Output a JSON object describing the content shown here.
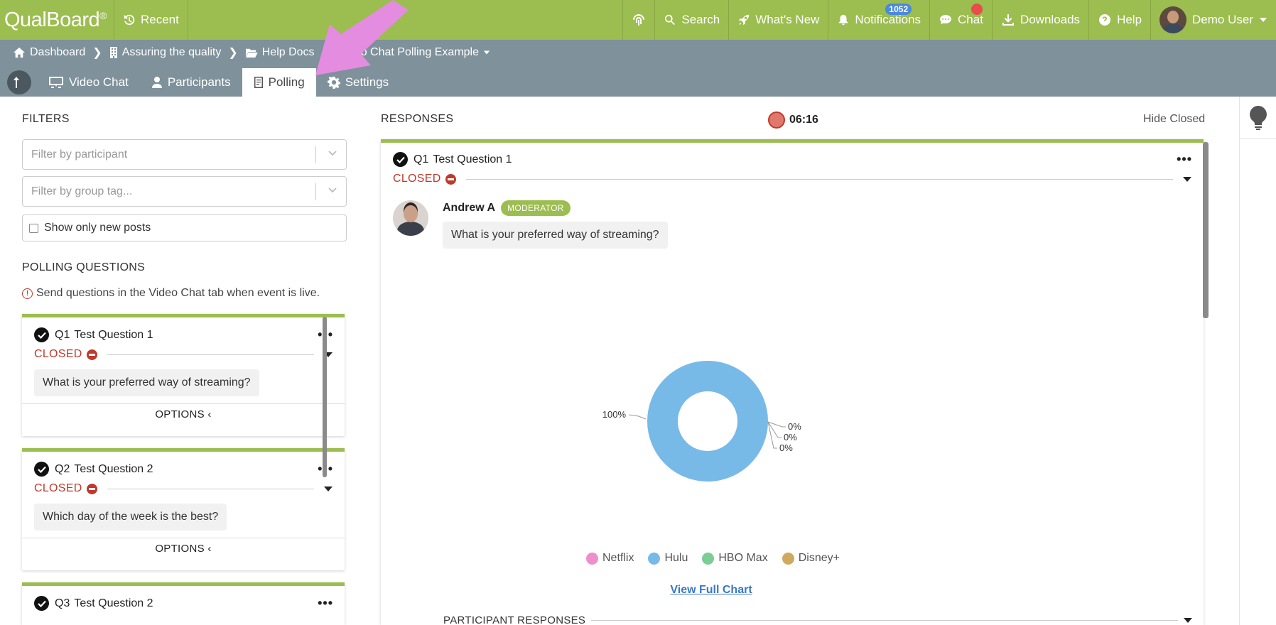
{
  "topbar": {
    "logo": "QualBoard",
    "recent": "Recent",
    "search": "Search",
    "whats_new": "What's New",
    "notifications": "Notifications",
    "notifications_count": "1052",
    "chat": "Chat",
    "downloads": "Downloads",
    "help": "Help",
    "user": "Demo User"
  },
  "breadcrumb": {
    "items": [
      "Dashboard",
      "Assuring the quality",
      "Help Docs",
      "Video Chat Polling Example"
    ]
  },
  "tabs": [
    "Video Chat",
    "Participants",
    "Polling",
    "Settings"
  ],
  "active_tab": "Polling",
  "filters": {
    "title": "FILTERS",
    "participant_placeholder": "Filter by participant",
    "group_tag_placeholder": "Filter by group tag...",
    "show_new_label": "Show only new posts"
  },
  "polling": {
    "title": "POLLING QUESTIONS",
    "notice": "Send questions in the Video Chat tab when event is live.",
    "questions": [
      {
        "num": "Q1",
        "title": "Test Question 1",
        "status": "CLOSED",
        "text": "What is your preferred way of streaming?",
        "options": "OPTIONS"
      },
      {
        "num": "Q2",
        "title": "Test Question 2",
        "status": "CLOSED",
        "text": "Which day of the week is the best?",
        "options": "OPTIONS"
      },
      {
        "num": "Q3",
        "title": "Test Question 2"
      }
    ]
  },
  "responses": {
    "title": "RESPONSES",
    "timer": "06:16",
    "hide_closed": "Hide Closed",
    "question": {
      "num": "Q1",
      "title": "Test Question 1",
      "status": "CLOSED"
    },
    "author": "Andrew A",
    "badge": "MODERATOR",
    "message": "What is your preferred way of streaming?",
    "view_full": "View Full Chart",
    "participant_responses": "PARTICIPANT RESPONSES"
  },
  "colors": {
    "brand_green": "#9cbd4f",
    "subbar": "#7f919b",
    "closed_red": "#c0392b"
  },
  "chart_data": {
    "type": "pie",
    "categories": [
      "Netflix",
      "Hulu",
      "HBO Max",
      "Disney+"
    ],
    "values": [
      0,
      100,
      0,
      0
    ],
    "labels": [
      "0%",
      "100%",
      "0%",
      "0%"
    ],
    "colors": [
      "#ee8fcb",
      "#77bae8",
      "#7ccc96",
      "#cfa95d"
    ],
    "legend": "bottom"
  }
}
